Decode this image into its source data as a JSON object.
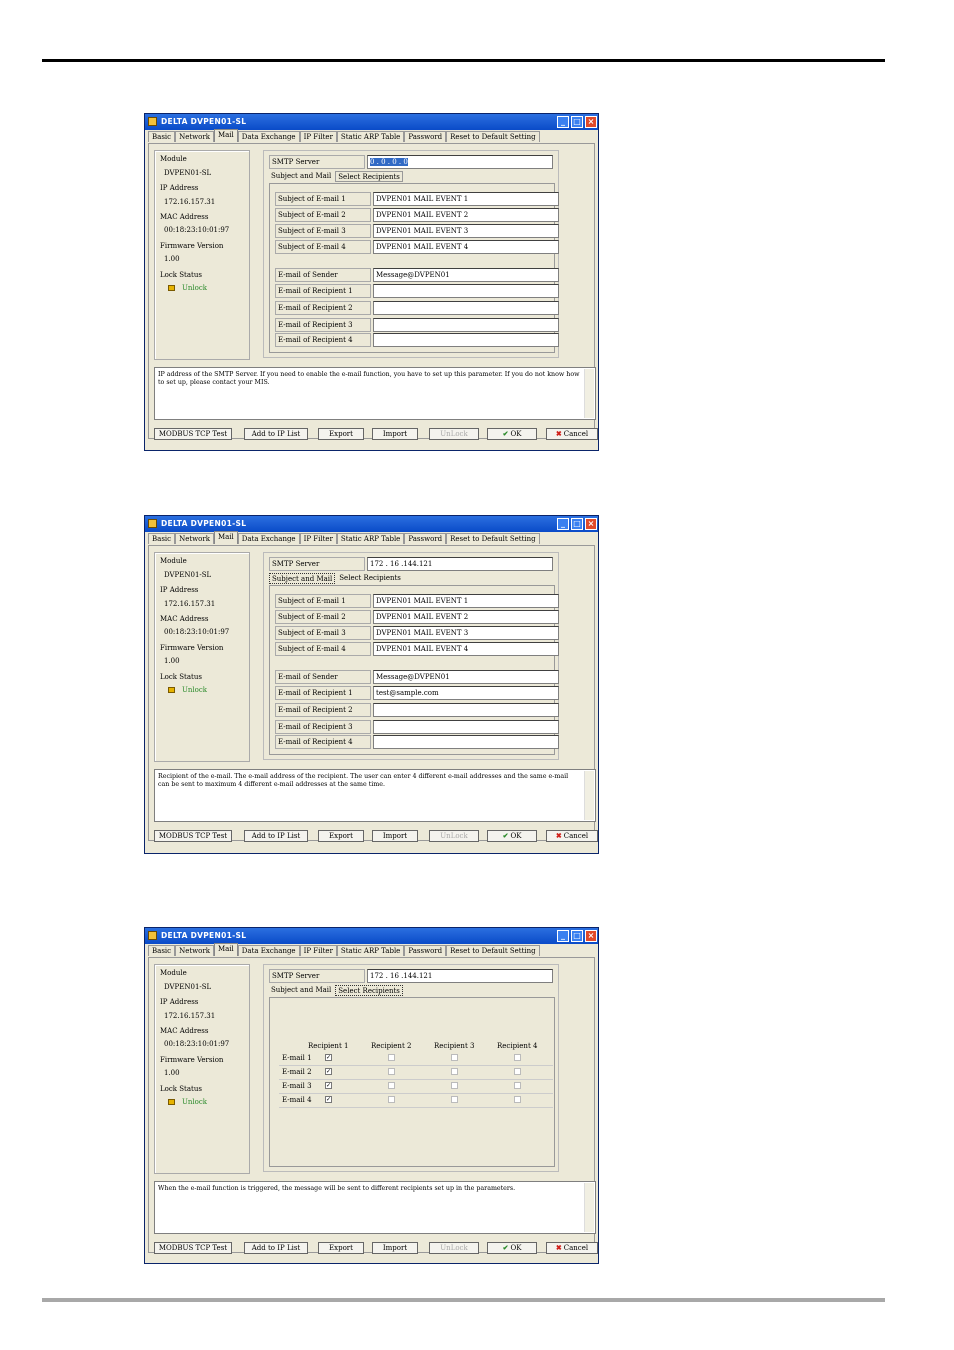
{
  "windows": [
    {
      "title": "DELTA DVPEN01-SL",
      "tabs": [
        "Basic",
        "Network",
        "Mail",
        "Data Exchange",
        "IP Filter",
        "Static ARP Table",
        "Password",
        "Reset to Default Setting"
      ],
      "info": {
        "module_label": "Module",
        "module_value": "DVPEN01-SL",
        "ip_label": "IP Address",
        "ip_value": "172.16.157.31",
        "mac_label": "MAC Address",
        "mac_value": "00:18:23:10:01:97",
        "fw_label": "Firmware Version",
        "fw_value": "1.00",
        "lock_label": "Lock Status",
        "lock_value": "Unlock"
      },
      "smtp_label": "SMTP Server",
      "smtp_value": "0 . 0 . 0 . 0",
      "subtabs": [
        "Subject and Mail",
        "Select Recipients"
      ],
      "rows": [
        {
          "label": "Subject of E-mail 1",
          "value": "DVPEN01 MAIL EVENT 1"
        },
        {
          "label": "Subject of E-mail 2",
          "value": "DVPEN01 MAIL EVENT 2"
        },
        {
          "label": "Subject of E-mail 3",
          "value": "DVPEN01 MAIL EVENT 3"
        },
        {
          "label": "Subject of E-mail 4",
          "value": "DVPEN01 MAIL EVENT 4"
        },
        {
          "label": "E-mail of Sender",
          "value": "Message@DVPEN01"
        },
        {
          "label": "E-mail of Recipient 1",
          "value": ""
        },
        {
          "label": "E-mail of Recipient 2",
          "value": ""
        },
        {
          "label": "E-mail of Recipient 3",
          "value": ""
        },
        {
          "label": "E-mail of Recipient 4",
          "value": ""
        }
      ],
      "description": "IP address of the SMTP Server. If you need to enable the e-mail function, you have to set up this parameter. If you do not know how to set up, please contact your MIS.",
      "buttons": [
        "MODBUS TCP Test",
        "Add to IP List",
        "Export",
        "Import",
        "UnLock",
        "OK",
        "Cancel"
      ]
    },
    {
      "title": "DELTA DVPEN01-SL",
      "tabs": [
        "Basic",
        "Network",
        "Mail",
        "Data Exchange",
        "IP Filter",
        "Static ARP Table",
        "Password",
        "Reset to Default Setting"
      ],
      "info": {
        "module_label": "Module",
        "module_value": "DVPEN01-SL",
        "ip_label": "IP Address",
        "ip_value": "172.16.157.31",
        "mac_label": "MAC Address",
        "mac_value": "00:18:23:10:01:97",
        "fw_label": "Firmware Version",
        "fw_value": "1.00",
        "lock_label": "Lock Status",
        "lock_value": "Unlock"
      },
      "smtp_label": "SMTP Server",
      "smtp_value": "172 . 16 .144.121",
      "subtabs": [
        "Subject and Mail",
        "Select Recipients"
      ],
      "rows": [
        {
          "label": "Subject of E-mail 1",
          "value": "DVPEN01 MAIL EVENT 1"
        },
        {
          "label": "Subject of E-mail 2",
          "value": "DVPEN01 MAIL EVENT 2"
        },
        {
          "label": "Subject of E-mail 3",
          "value": "DVPEN01 MAIL EVENT 3"
        },
        {
          "label": "Subject of E-mail 4",
          "value": "DVPEN01 MAIL EVENT 4"
        },
        {
          "label": "E-mail of Sender",
          "value": "Message@DVPEN01"
        },
        {
          "label": "E-mail of Recipient 1",
          "value": "test@sample.com"
        },
        {
          "label": "E-mail of Recipient 2",
          "value": ""
        },
        {
          "label": "E-mail of Recipient 3",
          "value": ""
        },
        {
          "label": "E-mail of Recipient 4",
          "value": ""
        }
      ],
      "description": "Recipient of the e-mail. The e-mail address of the recipient. The user can enter 4 different e-mail addresses and the same e-mail can be sent to maximum 4 different e-mail addresses at the same time.",
      "buttons": [
        "MODBUS TCP Test",
        "Add to IP List",
        "Export",
        "Import",
        "UnLock",
        "OK",
        "Cancel"
      ]
    },
    {
      "title": "DELTA DVPEN01-SL",
      "tabs": [
        "Basic",
        "Network",
        "Mail",
        "Data Exchange",
        "IP Filter",
        "Static ARP Table",
        "Password",
        "Reset to Default Setting"
      ],
      "info": {
        "module_label": "Module",
        "module_value": "DVPEN01-SL",
        "ip_label": "IP Address",
        "ip_value": "172.16.157.31",
        "mac_label": "MAC Address",
        "mac_value": "00:18:23:10:01:97",
        "fw_label": "Firmware Version",
        "fw_value": "1.00",
        "lock_label": "Lock Status",
        "lock_value": "Unlock"
      },
      "smtp_label": "SMTP Server",
      "smtp_value": "172 . 16 .144.121",
      "subtabs": [
        "Subject and Mail",
        "Select Recipients"
      ],
      "recipients": {
        "headers": [
          "Recipient 1",
          "Recipient 2",
          "Recipient 3",
          "Recipient 4"
        ],
        "rows": [
          {
            "label": "E-mail 1",
            "checked": [
              true,
              false,
              false,
              false
            ]
          },
          {
            "label": "E-mail 2",
            "checked": [
              true,
              false,
              false,
              false
            ]
          },
          {
            "label": "E-mail 3",
            "checked": [
              true,
              false,
              false,
              false
            ]
          },
          {
            "label": "E-mail 4",
            "checked": [
              true,
              false,
              false,
              false
            ]
          }
        ]
      },
      "description": "When the e-mail function is triggered, the message will be sent to different recipients set up in the parameters.",
      "buttons": [
        "MODBUS TCP Test",
        "Add to IP List",
        "Export",
        "Import",
        "UnLock",
        "OK",
        "Cancel"
      ]
    }
  ]
}
